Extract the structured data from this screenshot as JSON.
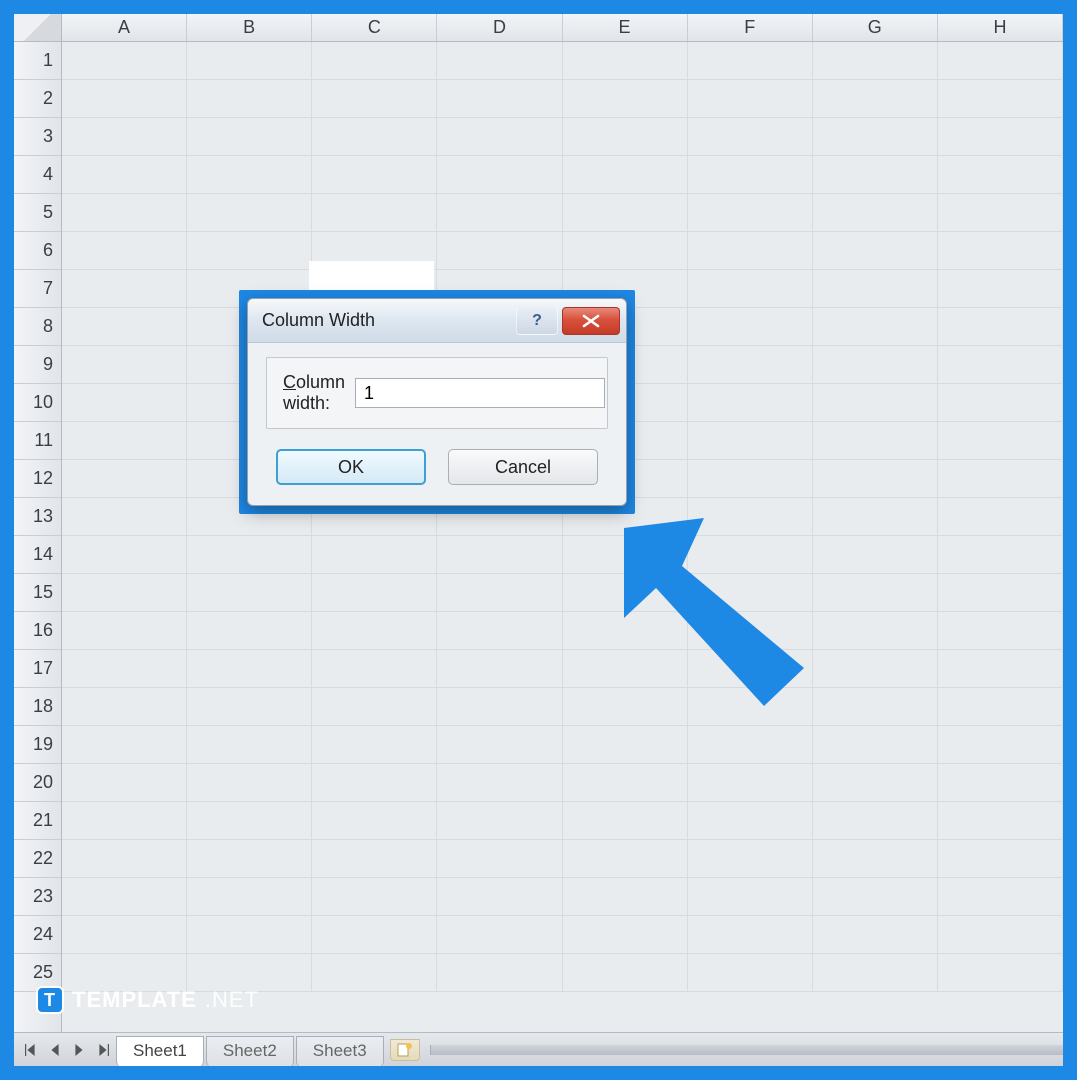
{
  "columns": [
    "A",
    "B",
    "C",
    "D",
    "E",
    "F",
    "G",
    "H"
  ],
  "rows": [
    "1",
    "2",
    "3",
    "4",
    "5",
    "6",
    "7",
    "8",
    "9",
    "10",
    "11",
    "12",
    "13",
    "14",
    "15",
    "16",
    "17",
    "18",
    "19",
    "20",
    "21",
    "22",
    "23",
    "24",
    "25"
  ],
  "sheets": {
    "active": "Sheet1",
    "tabs": [
      "Sheet1",
      "Sheet2",
      "Sheet3"
    ]
  },
  "dialog": {
    "title": "Column Width",
    "label_prefix": "C",
    "label_rest": "olumn width:",
    "value": "1",
    "ok": "OK",
    "cancel": "Cancel",
    "help_symbol": "?",
    "close_aria": "Close"
  },
  "watermark": {
    "logo_letter": "T",
    "bold": "TEMPLATE",
    "thin": ".NET"
  }
}
